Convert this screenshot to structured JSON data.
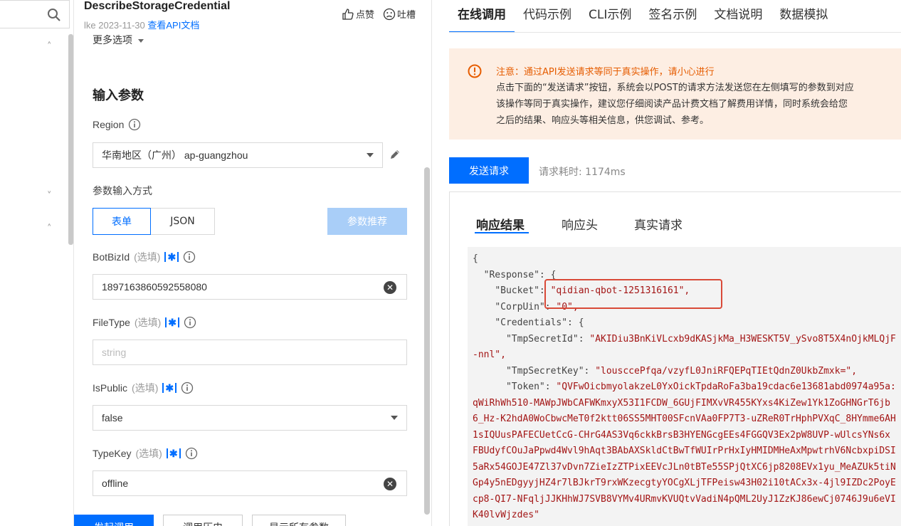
{
  "nav": {
    "chevron_up_1": "˄",
    "chevron_down": "˅",
    "chevron_up_2": "˄"
  },
  "header": {
    "api_name": "DescribeStorageCredential",
    "author_date": "lke 2023-11-30",
    "api_doc_link": "查看API文档",
    "like_label": "点赞",
    "complain_label": "吐槽"
  },
  "form": {
    "more_options": "更多选项",
    "section_title": "输入参数",
    "region_label": "Region",
    "region_value": "华南地区（广州） ap-guangzhou",
    "input_mode_label": "参数输入方式",
    "mode_form": "表单",
    "mode_json": "JSON",
    "recommend_label": "参数推荐",
    "optional_tag": "(选填)",
    "fields": {
      "botbizid": {
        "label": "BotBizId",
        "value": "1897163860592558080"
      },
      "filetype": {
        "label": "FileType",
        "placeholder": "string"
      },
      "ispublic": {
        "label": "IsPublic",
        "value": "false"
      },
      "typekey": {
        "label": "TypeKey",
        "value": "offline"
      }
    },
    "bottom_buttons": [
      "发起调用",
      "调用历史",
      "显示所有参数"
    ]
  },
  "right": {
    "tabs": [
      "在线调用",
      "代码示例",
      "CLI示例",
      "签名示例",
      "文档说明",
      "数据模拟"
    ],
    "active_tab": 0,
    "warning": {
      "title": "注意：通过API发送请求等同于真实操作，请小心进行",
      "lines": [
        "点击下面的“发送请求”按钮，系统会以POST的请求方法发送您在左侧填写的参数到对应",
        "该操作等同于真实操作，建议您仔细阅读产品计费文档了解费用详情，同时系统会给您",
        "之后的结果、响应头等相关信息，供您调试、参考。"
      ]
    },
    "send_button": "发送请求",
    "elapsed": "请求耗时: 1174ms",
    "result_tabs": [
      "响应结果",
      "响应头",
      "真实请求"
    ],
    "response_lines": [
      {
        "indent": "",
        "key": "{",
        "val": ""
      },
      {
        "indent": "  ",
        "key": "\"Response\": {",
        "val": ""
      },
      {
        "indent": "    ",
        "key": "\"Bucket\": ",
        "val": "\"qidian-qbot-1251316161\","
      },
      {
        "indent": "    ",
        "key": "\"CorpUin\": ",
        "val": "\"0\","
      },
      {
        "indent": "    ",
        "key": "\"Credentials\": {",
        "val": ""
      },
      {
        "indent": "      ",
        "key": "\"TmpSecretId\": ",
        "val": "\"AKIDiu3BnKiVLcxb9dKASjkMa_H3WESKT5V_ySvo8T5X4nOjkMLQjF"
      },
      {
        "indent": "",
        "key": "",
        "val": "-nnl\","
      },
      {
        "indent": "      ",
        "key": "\"TmpSecretKey\": ",
        "val": "\"lousccePfqa/vzyfL0JniRFQEPqTIEtQdnZ0UkbZmxk=\","
      },
      {
        "indent": "      ",
        "key": "\"Token\": ",
        "val": "\"QVFwOicbmyolakzeL0YxOickTpdaRoFa3ba19cdac6e13681abd0974a95a:"
      },
      {
        "indent": "",
        "key": "",
        "val": "qWiRhWh510-MAWpJWbCAFWKmxyX53I1FCDW_6GUjFIMXvVR455KYxs4KiZew1Yk1ZoGHNGrT6jb"
      },
      {
        "indent": "",
        "key": "",
        "val": "6_Hz-K2hdA0WoCbwcMeT0f2ktt06SS5MHT00SFcnVAa0FP7T3-uZReR0TrHphPVXqC_8HYmme6AH"
      },
      {
        "indent": "",
        "key": "",
        "val": "1sIQUusPAFECUetCcG-CHrG4AS3Vq6ckkBrsB3HYENGcgEEs4FGGQV3Ex2pW8UVP-wUlcsYNs6x"
      },
      {
        "indent": "",
        "key": "",
        "val": "FBUdyfCOuJaPpwd4Wvl9hAqt3BAbAXSkldCtBwTfWUIrPrHxIyHMIDMHeAxMpwtrhV6NcbxpiDSI"
      },
      {
        "indent": "",
        "key": "",
        "val": "5aRx54GOJE47Zl37vDvn7ZieIzZTPixEEVcJLn0tBTe55SPjQtXC6jp8208EVx1yu_MeAZUk5tiN"
      },
      {
        "indent": "",
        "key": "",
        "val": "Gp4y5nEDgyyjHZ4r7lBJkrT9rxWKzecgtyYOCgXLjTFPeisw43H02i10tACx3x-4jl9IZDc2PoyE"
      },
      {
        "indent": "",
        "key": "",
        "val": "cp8-QI7-NFqljJJKHhWJ7SVB8VYMv4URmvKVUQtvVadiN4pQML2UyJ1ZzKJ86ewCj0746J9u6eVI"
      },
      {
        "indent": "",
        "key": "",
        "val": "K40lvWjzdes\""
      }
    ]
  },
  "colors": {
    "brand_blue": "#006eff",
    "warning_orange": "#e65c00",
    "highlight_red": "#d94a38"
  }
}
